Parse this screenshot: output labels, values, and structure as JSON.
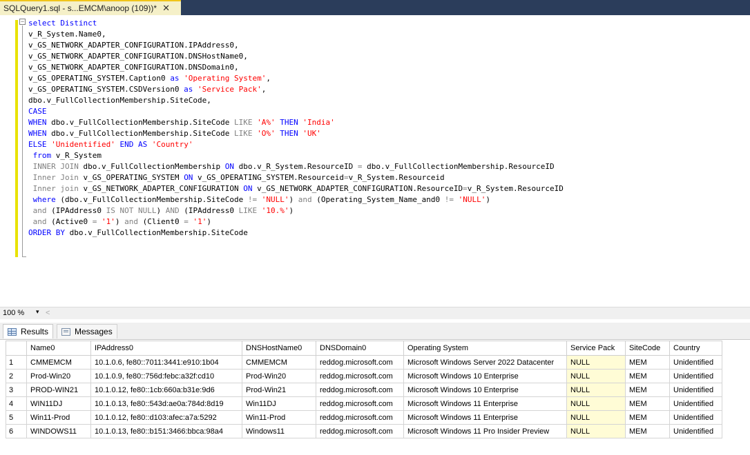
{
  "tab": {
    "title": "SQLQuery1.sql - s...EMCM\\anoop (109))*",
    "close_glyph": "✕"
  },
  "editor": {
    "collapse_glyph": "−",
    "lines": [
      [
        {
          "t": "select Distinct",
          "c": "kw"
        }
      ],
      [
        {
          "t": "v_R_System.Name0,"
        }
      ],
      [
        {
          "t": "v_GS_NETWORK_ADAPTER_CONFIGURATION.IPAddress0,"
        }
      ],
      [
        {
          "t": "v_GS_NETWORK_ADAPTER_CONFIGURATION.DNSHostName0,"
        }
      ],
      [
        {
          "t": "v_GS_NETWORK_ADAPTER_CONFIGURATION.DNSDomain0,"
        }
      ],
      [
        {
          "t": "v_GS_OPERATING_SYSTEM.Caption0 "
        },
        {
          "t": "as",
          "c": "kw"
        },
        {
          "t": " "
        },
        {
          "t": "'Operating System'",
          "c": "str"
        },
        {
          "t": ","
        }
      ],
      [
        {
          "t": "v_GS_OPERATING_SYSTEM.CSDVersion0 "
        },
        {
          "t": "as",
          "c": "kw"
        },
        {
          "t": " "
        },
        {
          "t": "'Service Pack'",
          "c": "str"
        },
        {
          "t": ","
        }
      ],
      [
        {
          "t": "dbo.v_FullCollectionMembership.SiteCode,"
        }
      ],
      [
        {
          "t": "CASE",
          "c": "kw"
        }
      ],
      [
        {
          "t": "WHEN",
          "c": "kw"
        },
        {
          "t": " dbo.v_FullCollectionMembership.SiteCode "
        },
        {
          "t": "LIKE",
          "c": "gray"
        },
        {
          "t": " "
        },
        {
          "t": "'A%'",
          "c": "str"
        },
        {
          "t": " "
        },
        {
          "t": "THEN",
          "c": "kw"
        },
        {
          "t": " "
        },
        {
          "t": "'India'",
          "c": "str"
        }
      ],
      [
        {
          "t": "WHEN",
          "c": "kw"
        },
        {
          "t": " dbo.v_FullCollectionMembership.SiteCode "
        },
        {
          "t": "LIKE",
          "c": "gray"
        },
        {
          "t": " "
        },
        {
          "t": "'O%'",
          "c": "str"
        },
        {
          "t": " "
        },
        {
          "t": "THEN",
          "c": "kw"
        },
        {
          "t": " "
        },
        {
          "t": "'UK'",
          "c": "str"
        }
      ],
      [
        {
          "t": "ELSE",
          "c": "kw"
        },
        {
          "t": " "
        },
        {
          "t": "'Unidentified'",
          "c": "str"
        },
        {
          "t": " "
        },
        {
          "t": "END AS",
          "c": "kw"
        },
        {
          "t": " "
        },
        {
          "t": "'Country'",
          "c": "str"
        }
      ],
      [
        {
          "t": " "
        },
        {
          "t": "from",
          "c": "kw"
        },
        {
          "t": " v_R_System"
        }
      ],
      [
        {
          "t": " "
        },
        {
          "t": "INNER JOIN",
          "c": "gray"
        },
        {
          "t": " dbo.v_FullCollectionMembership "
        },
        {
          "t": "ON",
          "c": "kw"
        },
        {
          "t": " dbo.v_R_System.ResourceID "
        },
        {
          "t": "=",
          "c": "gray"
        },
        {
          "t": " dbo.v_FullCollectionMembership.ResourceID"
        }
      ],
      [
        {
          "t": " "
        },
        {
          "t": "Inner Join",
          "c": "gray"
        },
        {
          "t": " v_GS_OPERATING_SYSTEM "
        },
        {
          "t": "ON",
          "c": "kw"
        },
        {
          "t": " v_GS_OPERATING_SYSTEM.Resourceid"
        },
        {
          "t": "=",
          "c": "gray"
        },
        {
          "t": "v_R_System.Resourceid"
        }
      ],
      [
        {
          "t": " "
        },
        {
          "t": "Inner join",
          "c": "gray"
        },
        {
          "t": " v_GS_NETWORK_ADAPTER_CONFIGURATION "
        },
        {
          "t": "ON",
          "c": "kw"
        },
        {
          "t": " v_GS_NETWORK_ADAPTER_CONFIGURATION.ResourceID"
        },
        {
          "t": "=",
          "c": "gray"
        },
        {
          "t": "v_R_System.ResourceID"
        }
      ],
      [
        {
          "t": " "
        },
        {
          "t": "where",
          "c": "kw"
        },
        {
          "t": " (dbo.v_FullCollectionMembership.SiteCode "
        },
        {
          "t": "!=",
          "c": "gray"
        },
        {
          "t": " "
        },
        {
          "t": "'NULL'",
          "c": "str"
        },
        {
          "t": ") "
        },
        {
          "t": "and",
          "c": "gray"
        },
        {
          "t": " (Operating_System_Name_and0 "
        },
        {
          "t": "!=",
          "c": "gray"
        },
        {
          "t": " "
        },
        {
          "t": "'NULL'",
          "c": "str"
        },
        {
          "t": ")"
        }
      ],
      [
        {
          "t": " "
        },
        {
          "t": "and",
          "c": "gray"
        },
        {
          "t": " (IPAddress0 "
        },
        {
          "t": "IS NOT NULL",
          "c": "gray"
        },
        {
          "t": ") "
        },
        {
          "t": "AND",
          "c": "gray"
        },
        {
          "t": " (IPAddress0 "
        },
        {
          "t": "LIKE",
          "c": "gray"
        },
        {
          "t": " "
        },
        {
          "t": "'10.%'",
          "c": "str"
        },
        {
          "t": ")"
        }
      ],
      [
        {
          "t": " "
        },
        {
          "t": "and",
          "c": "gray"
        },
        {
          "t": " (Active0 "
        },
        {
          "t": "=",
          "c": "gray"
        },
        {
          "t": " "
        },
        {
          "t": "'1'",
          "c": "str"
        },
        {
          "t": ") "
        },
        {
          "t": "and",
          "c": "gray"
        },
        {
          "t": " (Client0 "
        },
        {
          "t": "=",
          "c": "gray"
        },
        {
          "t": " "
        },
        {
          "t": "'1'",
          "c": "str"
        },
        {
          "t": ")"
        }
      ],
      [
        {
          "t": "ORDER BY",
          "c": "kw"
        },
        {
          "t": " dbo.v_FullCollectionMembership.SiteCode"
        }
      ]
    ]
  },
  "zoom": {
    "level": "100 %",
    "arrow": "▾",
    "scroll": "<"
  },
  "results_tabs": [
    {
      "label": "Results",
      "active": true
    },
    {
      "label": "Messages",
      "active": false
    }
  ],
  "grid": {
    "columns": [
      "",
      "Name0",
      "IPAddress0",
      "DNSHostName0",
      "DNSDomain0",
      "Operating System",
      "Service Pack",
      "SiteCode",
      "Country"
    ],
    "rows": [
      [
        "1",
        "CMMEMCM",
        "10.1.0.6, fe80::7011:3441:e910:1b04",
        "CMMEMCM",
        "reddog.microsoft.com",
        "Microsoft Windows Server 2022 Datacenter",
        "NULL",
        "MEM",
        "Unidentified"
      ],
      [
        "2",
        "Prod-Win20",
        "10.1.0.9, fe80::756d:febc:a32f:cd10",
        "Prod-Win20",
        "reddog.microsoft.com",
        "Microsoft Windows 10 Enterprise",
        "NULL",
        "MEM",
        "Unidentified"
      ],
      [
        "3",
        "PROD-WIN21",
        "10.1.0.12, fe80::1cb:660a:b31e:9d6",
        "Prod-Win21",
        "reddog.microsoft.com",
        "Microsoft Windows 10 Enterprise",
        "NULL",
        "MEM",
        "Unidentified"
      ],
      [
        "4",
        "WIN11DJ",
        "10.1.0.13, fe80::543d:ae0a:784d:8d19",
        "Win11DJ",
        "reddog.microsoft.com",
        "Microsoft Windows 11 Enterprise",
        "NULL",
        "MEM",
        "Unidentified"
      ],
      [
        "5",
        "Win11-Prod",
        "10.1.0.12, fe80::d103:afec:a7a:5292",
        "Win11-Prod",
        "reddog.microsoft.com",
        "Microsoft Windows 11 Enterprise",
        "NULL",
        "MEM",
        "Unidentified"
      ],
      [
        "6",
        "WINDOWS11",
        "10.1.0.13, fe80::b151:3466:bbca:98a4",
        "Windows11",
        "reddog.microsoft.com",
        "Microsoft Windows 11 Pro Insider Preview",
        "NULL",
        "MEM",
        "Unidentified"
      ]
    ]
  }
}
